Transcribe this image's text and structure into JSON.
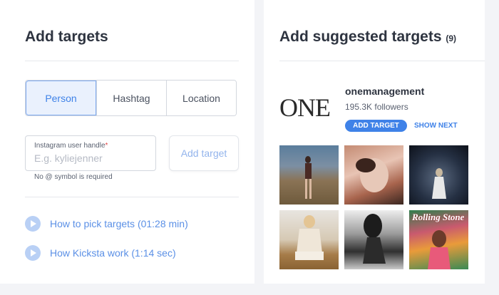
{
  "left": {
    "title": "Add targets",
    "tabs": [
      {
        "label": "Person",
        "active": true
      },
      {
        "label": "Hashtag",
        "active": false
      },
      {
        "label": "Location",
        "active": false
      }
    ],
    "handle_field": {
      "label": "Instagram user handle",
      "required_mark": "*",
      "placeholder": "E.g. kyliejenner",
      "value": ""
    },
    "hint": "No @ symbol is required",
    "add_target_label": "Add target",
    "video_links": [
      {
        "label": "How to pick targets (01:28 min)",
        "icon": "play-icon"
      },
      {
        "label": "How Kicksta work (1:14 sec)",
        "icon": "play-icon"
      }
    ]
  },
  "right": {
    "title": "Add suggested targets",
    "count": "(9)",
    "account": {
      "logo_text": "ONE",
      "name": "onemanagement",
      "followers": "195.3K followers"
    },
    "add_target_label": "ADD TARGET",
    "show_next_label": "SHOW NEXT",
    "thumbnails": [
      {
        "alt": "photo-1"
      },
      {
        "alt": "photo-2"
      },
      {
        "alt": "photo-3"
      },
      {
        "alt": "photo-4"
      },
      {
        "alt": "photo-5"
      },
      {
        "alt": "photo-6",
        "overlay_text": "Rolling Stone"
      }
    ]
  },
  "colors": {
    "accent": "#3f82e8",
    "tab_active_bg": "#eaf1fd",
    "page_bg": "#f3f4f7",
    "link": "#5b90e6"
  }
}
